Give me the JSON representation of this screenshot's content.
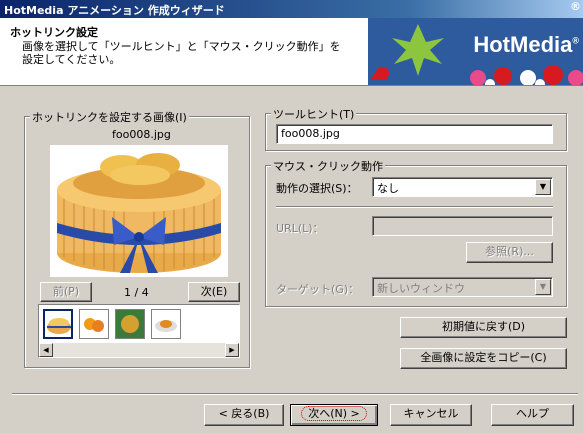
{
  "window": {
    "title": "HotMedia アニメーション 作成ウィザード",
    "title_mark": "®"
  },
  "banner": {
    "heading": "ホットリンク設定",
    "description_line1": "画像を選択して「ツールヒント」と「マウス・クリック動作」を",
    "description_line2": "設定してください。",
    "brand": "HotMedia",
    "brand_mark": "®"
  },
  "image_group": {
    "label": "ホットリンクを設定する画像(I)",
    "filename": "foo008.jpg",
    "prev_label": "前(P)",
    "counter": "1 / 4",
    "next_label": "次(E)",
    "thumbnails": [
      "cake",
      "oranges",
      "pie",
      "plate"
    ]
  },
  "tooltip_group": {
    "label": "ツールヒント(T)",
    "value": "foo008.jpg"
  },
  "mouse_group": {
    "label": "マウス・クリック動作",
    "action_label": "動作の選択(S)：",
    "action_value": "なし",
    "url_label": "URL(L)：",
    "url_value": "",
    "browse_label": "参照(R)...",
    "target_label": "ターゲット(G)：",
    "target_value": "新しいウィンドウ"
  },
  "side_buttons": {
    "reset_label": "初期値に戻す(D)",
    "copy_all_label": "全画像に設定をコピー(C)"
  },
  "footer": {
    "back_label": "< 戻る(B)",
    "next_label": "次へ(N) >",
    "cancel_label": "キャンセル",
    "help_label": "ヘルプ"
  },
  "colors": {
    "titlebar": "#0a246a",
    "banner_bg": "#2d5b9e",
    "window_bg": "#d4d0c8"
  }
}
